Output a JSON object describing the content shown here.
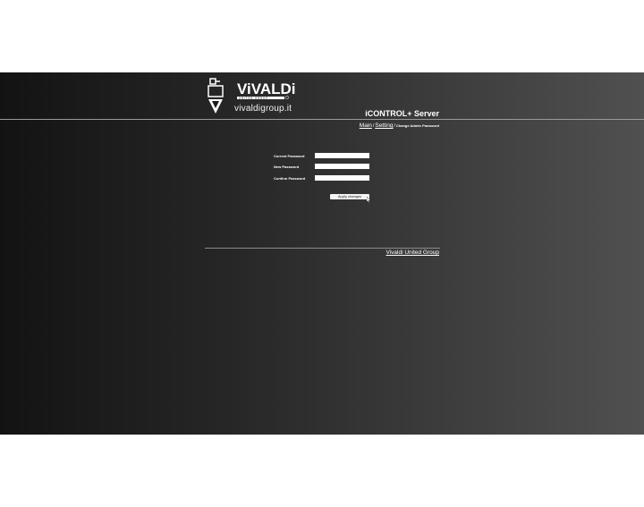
{
  "header": {
    "logo_wordmark": "ViVALDi",
    "logo_tagline": "UNITED GROUP",
    "brand_url": "vivaldigroup.it",
    "app_title": "iCONTROL+ Server"
  },
  "breadcrumb": {
    "items": [
      "Main",
      "Setting"
    ],
    "separator": "/",
    "current": "Change Admin Password"
  },
  "form": {
    "fields": [
      {
        "label": "Current Password",
        "value": ""
      },
      {
        "label": "New Password",
        "value": ""
      },
      {
        "label": "Confirm Password",
        "value": ""
      }
    ],
    "submit_label": "Apply changes"
  },
  "footer": {
    "link_text": "Vivaldi United Group"
  },
  "icons": [
    "vivaldi-logo-icon",
    "mouse-cursor-icon"
  ],
  "colors": {
    "background_dark": "#131313",
    "background_light": "#505050",
    "text": "#ffffff",
    "rule": "#9a9a9a"
  }
}
